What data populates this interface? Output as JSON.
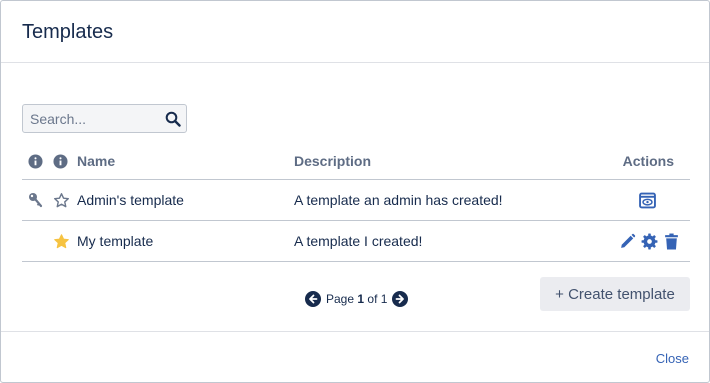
{
  "dialog": {
    "title": "Templates"
  },
  "search": {
    "placeholder": "Search...",
    "value": ""
  },
  "table": {
    "headers": {
      "name": "Name",
      "description": "Description",
      "actions": "Actions"
    },
    "rows": [
      {
        "name": "Admin's template",
        "description": "A template an admin has created!",
        "admin_icon": "key-icon",
        "favorite": false,
        "actions": [
          "preview-icon"
        ]
      },
      {
        "name": "My template",
        "description": "A template I created!",
        "admin_icon": "",
        "favorite": true,
        "actions": [
          "edit-icon",
          "settings-icon",
          "delete-icon"
        ]
      }
    ]
  },
  "pagination": {
    "page_label": "Page",
    "current_page": "1",
    "of_label": "of",
    "total_pages": "1"
  },
  "buttons": {
    "create_template": "+ Create template",
    "close": "Close"
  },
  "colors": {
    "accent": "#3563b5",
    "dark_icon": "#172b4d",
    "star_filled": "#f6c342",
    "header_icon": "#5e6c84"
  }
}
